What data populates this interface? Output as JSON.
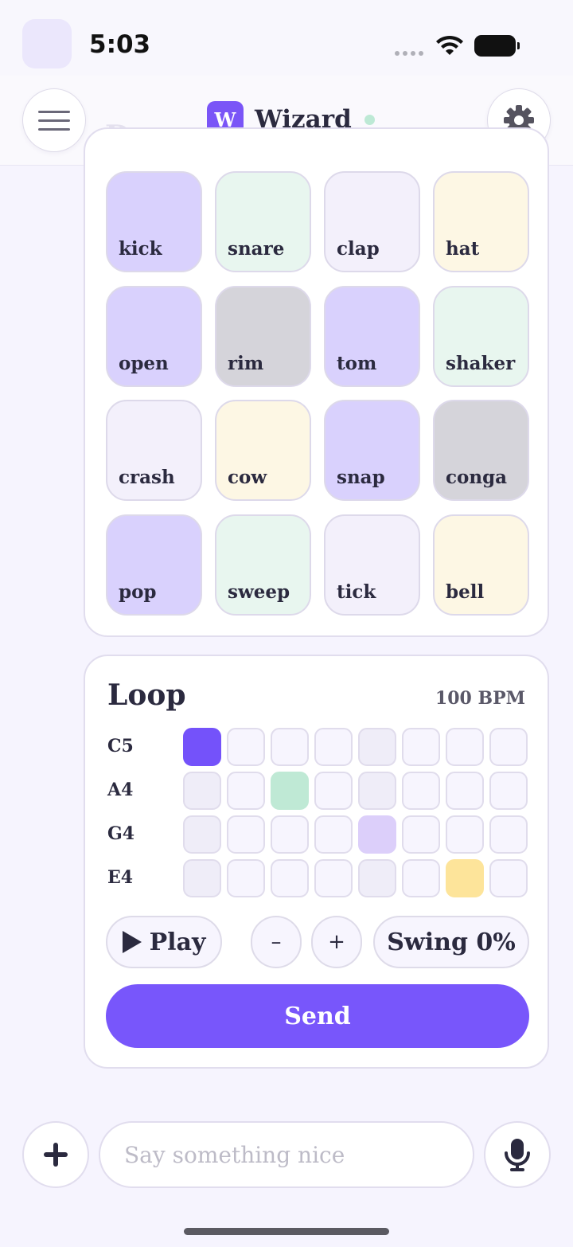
{
  "status_bar": {
    "time": "5:03"
  },
  "header": {
    "ghost_title": "Drums",
    "brand_initial": "W",
    "brand_name": "Wizard"
  },
  "drums": {
    "pads": [
      {
        "label": "kick",
        "color": "#d9d1fd"
      },
      {
        "label": "snare",
        "color": "#e8f6ef"
      },
      {
        "label": "clap",
        "color": "#f3f0fb"
      },
      {
        "label": "hat",
        "color": "#fdf7e4"
      },
      {
        "label": "open",
        "color": "#d9d1fd"
      },
      {
        "label": "rim",
        "color": "#d5d4da"
      },
      {
        "label": "tom",
        "color": "#d9d1fd"
      },
      {
        "label": "shaker",
        "color": "#e8f6ef"
      },
      {
        "label": "crash",
        "color": "#f3f0fb"
      },
      {
        "label": "cow",
        "color": "#fdf7e4"
      },
      {
        "label": "snap",
        "color": "#d9d1fd"
      },
      {
        "label": "conga",
        "color": "#d5d4da"
      },
      {
        "label": "pop",
        "color": "#d9d1fd"
      },
      {
        "label": "sweep",
        "color": "#e8f6ef"
      },
      {
        "label": "tick",
        "color": "#f3f0fb"
      },
      {
        "label": "bell",
        "color": "#fdf7e4"
      }
    ]
  },
  "loop": {
    "title": "Loop",
    "bpm": "100 BPM",
    "rows": [
      {
        "note": "C5",
        "active_step": 0,
        "active_color": "#7452fa"
      },
      {
        "note": "A4",
        "active_step": 2,
        "active_color": "#bfe9d5"
      },
      {
        "note": "G4",
        "active_step": 4,
        "active_color": "#dccffa"
      },
      {
        "note": "E4",
        "active_step": 6,
        "active_color": "#fde49a"
      }
    ],
    "steps": 8,
    "play_label": "Play",
    "minus_label": "–",
    "plus_label": "+",
    "swing_label": "Swing 0%",
    "send_label": "Send"
  },
  "composer": {
    "placeholder": "Say something nice"
  },
  "colors": {
    "accent": "#7856fb",
    "online": "#bde9d5"
  }
}
